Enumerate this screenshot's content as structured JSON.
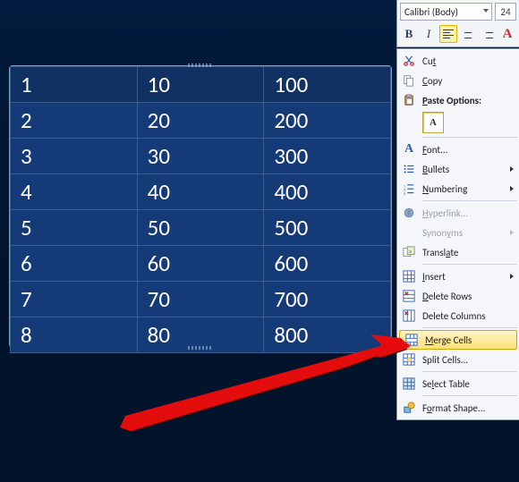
{
  "toolbar": {
    "font": "Calibri (Body)",
    "size": "24"
  },
  "table": {
    "rows": [
      [
        "1",
        "10",
        "100"
      ],
      [
        "2",
        "20",
        "200"
      ],
      [
        "3",
        "30",
        "300"
      ],
      [
        "4",
        "40",
        "400"
      ],
      [
        "5",
        "50",
        "500"
      ],
      [
        "6",
        "60",
        "600"
      ],
      [
        "7",
        "70",
        "700"
      ],
      [
        "8",
        "80",
        "800"
      ]
    ]
  },
  "menu": {
    "cut": {
      "pre": "Cu",
      "acc": "t"
    },
    "copy": {
      "acc": "C",
      "post": "opy"
    },
    "paste": {
      "acc": "P",
      "post": "aste Options:"
    },
    "font": {
      "acc": "F",
      "post": "ont..."
    },
    "bullets": {
      "acc": "B",
      "post": "ullets"
    },
    "numbering": {
      "acc": "N",
      "post": "umbering"
    },
    "hyperlink": {
      "acc": "H",
      "post": "yperlink..."
    },
    "synonyms": {
      "pre": "Synon",
      "acc": "y",
      "post": "ms"
    },
    "translate": {
      "pre": "Transl",
      "acc": "a",
      "post": "te"
    },
    "insert": {
      "acc": "I",
      "post": "nsert"
    },
    "deleteRows": {
      "acc": "D",
      "post": "elete Rows"
    },
    "deleteCols": {
      "label": "Delete Columns"
    },
    "merge": {
      "acc": "M",
      "post": "erge Cells"
    },
    "split": {
      "label": "Split Cells..."
    },
    "selectTable": {
      "pre": "Se",
      "acc": "l",
      "post": "ect Table"
    },
    "formatShape": {
      "pre": "F",
      "acc": "o",
      "post": "rmat Shape..."
    }
  }
}
